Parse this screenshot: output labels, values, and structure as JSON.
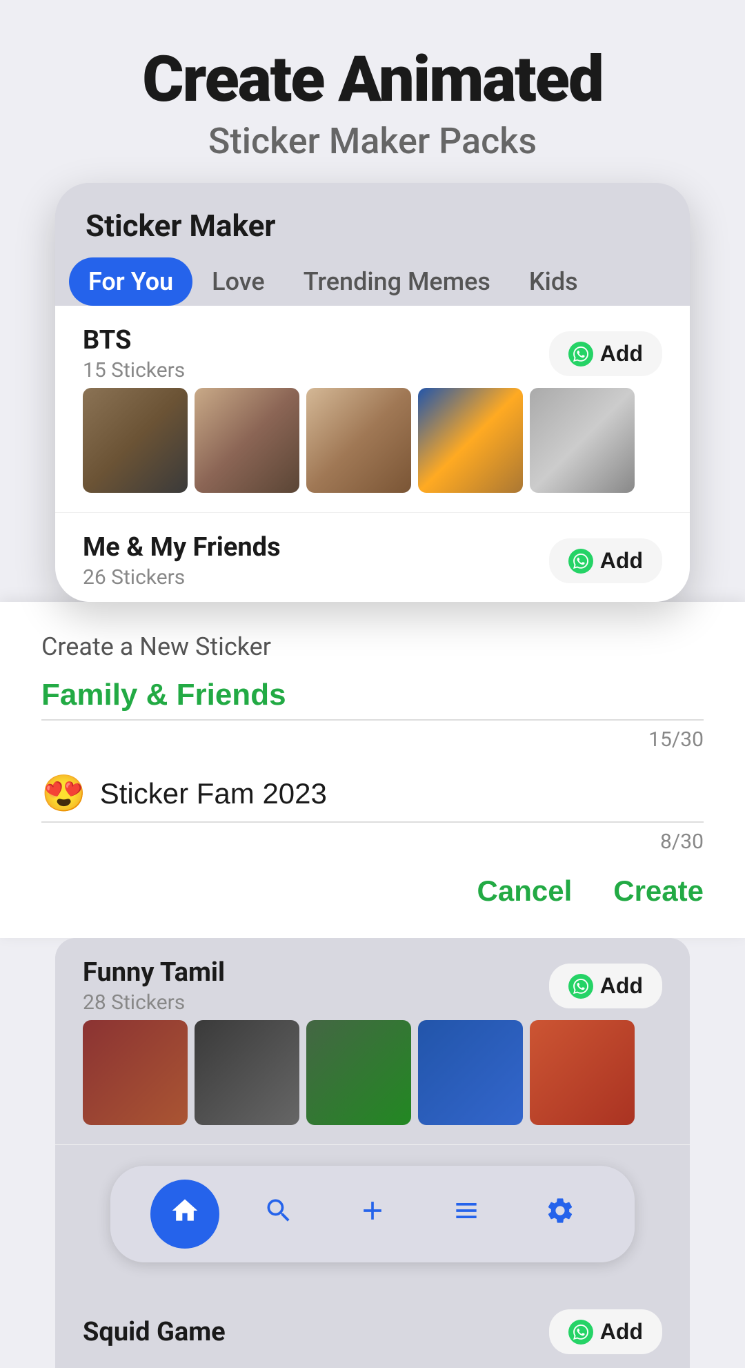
{
  "header": {
    "title_line1": "Create Animated",
    "title_line2": "Sticker Maker Packs"
  },
  "app": {
    "title": "Sticker Maker"
  },
  "tabs": [
    {
      "label": "For You",
      "active": true
    },
    {
      "label": "Love",
      "active": false
    },
    {
      "label": "Trending Memes",
      "active": false
    },
    {
      "label": "Kids",
      "active": false
    }
  ],
  "packs": [
    {
      "name": "BTS",
      "count": "15 Stickers",
      "add_label": "Add"
    },
    {
      "name": "Me & My Friends",
      "count": "26 Stickers",
      "add_label": "Add"
    },
    {
      "name": "Funny Tamil",
      "count": "28 Stickers",
      "add_label": "Add"
    },
    {
      "name": "Squid Game",
      "count": "",
      "add_label": "Add"
    }
  ],
  "create_section": {
    "label": "Create a New Sticker",
    "input1_value": "Family & Friends",
    "input1_count": "15/30",
    "input2_emoji": "😍",
    "input2_value": "Sticker Fam 2023",
    "input2_count": "8/30",
    "cancel_label": "Cancel",
    "create_label": "Create"
  },
  "bottom_nav": {
    "items": [
      {
        "icon": "🏠",
        "label": "home",
        "active": true
      },
      {
        "icon": "🔍",
        "label": "search",
        "active": false
      },
      {
        "icon": "➕",
        "label": "add",
        "active": false
      },
      {
        "icon": "📋",
        "label": "collections",
        "active": false
      },
      {
        "icon": "⚙️",
        "label": "settings",
        "active": false
      }
    ]
  }
}
